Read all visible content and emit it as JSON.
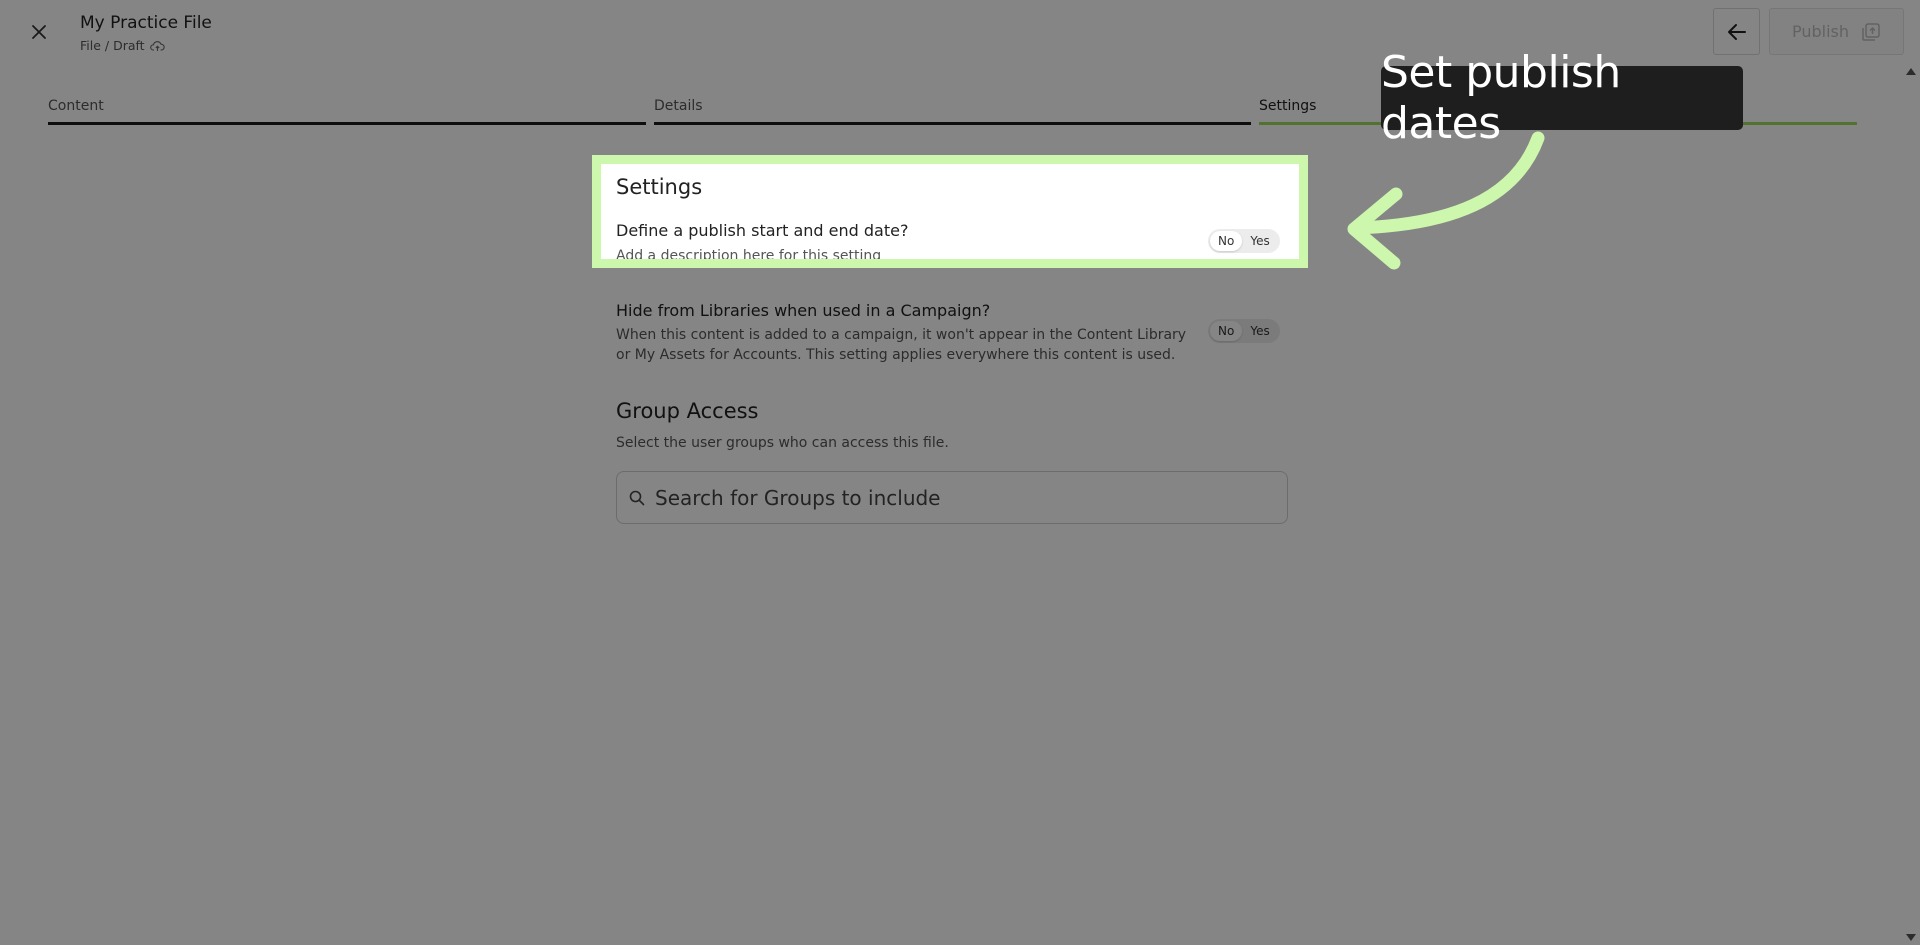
{
  "header": {
    "title": "My Practice File",
    "breadcrumb": "File / Draft",
    "publish_label": "Publish"
  },
  "tabs": [
    {
      "label": "Content",
      "active": false
    },
    {
      "label": "Details",
      "active": false
    },
    {
      "label": "Settings",
      "active": true
    }
  ],
  "settings": {
    "heading": "Settings",
    "publish_dates": {
      "question": "Define a publish start and end date?",
      "description": "Add a description here for this setting",
      "options": [
        "No",
        "Yes"
      ],
      "selected": "No"
    },
    "hide_libraries": {
      "question": "Hide from Libraries when used in a Campaign?",
      "description": "When this content is added to a campaign, it won't appear in the Content Library or My Assets for Accounts. This setting applies everywhere this content is used.",
      "options": [
        "No",
        "Yes"
      ],
      "selected": "No"
    }
  },
  "group_access": {
    "heading": "Group Access",
    "description": "Select the user groups who can access this file.",
    "search_placeholder": "Search for Groups to include"
  },
  "tutorial": {
    "callout_text": "Set publish dates",
    "highlight_color": "#cdf7ac",
    "arrow_color": "#cdf7ac"
  },
  "colors": {
    "active_tab_underline": "#9edc5c",
    "tab_underline": "#1c1c1c"
  }
}
